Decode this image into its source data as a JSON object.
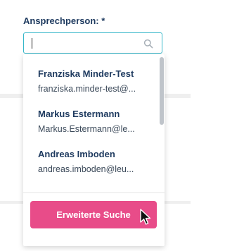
{
  "form": {
    "label": "Ansprechperson: *",
    "search": {
      "value": "",
      "icon": "search-icon"
    }
  },
  "dropdown": {
    "items": [
      {
        "name": "Franziska Minder-Test",
        "email": "franziska.minder-test@..."
      },
      {
        "name": "Markus Estermann",
        "email": "Markus.Estermann@le..."
      },
      {
        "name": "Andreas Imboden",
        "email": "andreas.imboden@leu..."
      },
      {
        "name": "",
        "email": ""
      }
    ],
    "advanced_search_label": "Erweiterte Suche"
  },
  "colors": {
    "accent": "#35b7c9",
    "button": "#e84c89",
    "text": "#1e3a5f"
  }
}
